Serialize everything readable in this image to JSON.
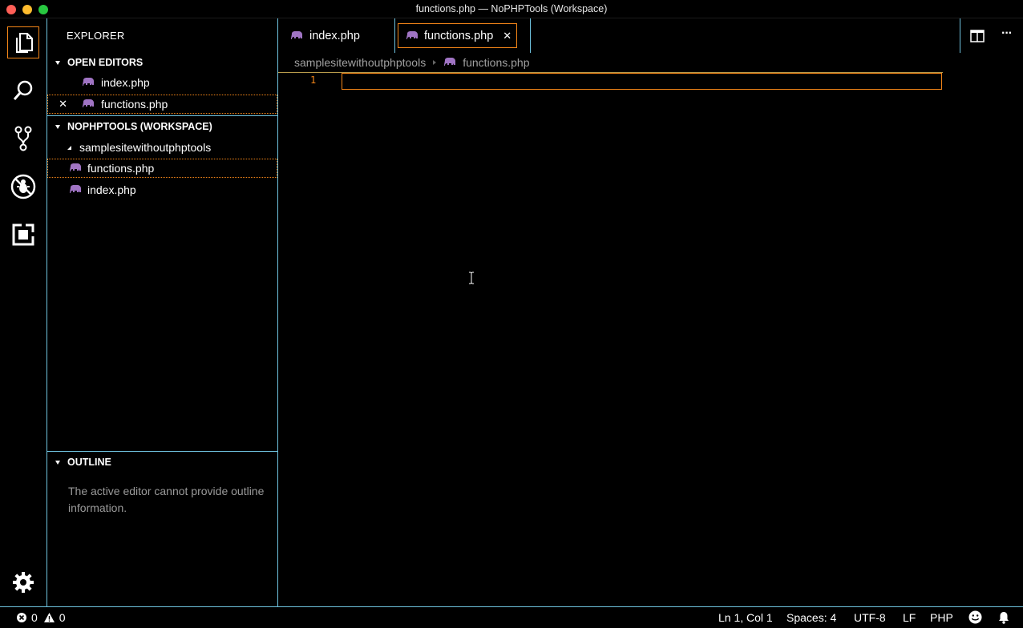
{
  "window": {
    "title": "functions.php — NoPHPTools (Workspace)",
    "traffic_colors": {
      "close": "#ff5f57",
      "minimize": "#febc2e",
      "maximize": "#28c840"
    }
  },
  "theme": {
    "focus_color": "#f38518",
    "border_color": "#6fc3df",
    "php_icon_color": "#a074c4"
  },
  "activity_bar": {
    "items": [
      {
        "name": "explorer-icon",
        "active": true
      },
      {
        "name": "search-icon"
      },
      {
        "name": "source-control-icon"
      },
      {
        "name": "debug-icon"
      },
      {
        "name": "extensions-icon"
      },
      {
        "name": "gear-icon"
      }
    ]
  },
  "sidebar": {
    "title": "EXPLORER",
    "open_editors": {
      "header": "OPEN EDITORS",
      "items": [
        {
          "label": "index.php",
          "icon": "php-elephant-icon"
        },
        {
          "label": "functions.php",
          "icon": "php-elephant-icon",
          "close_glyph": "✕"
        }
      ]
    },
    "workspace": {
      "header": "NOPHPTOOLS (WORKSPACE)",
      "folder": "samplesitewithoutphptools",
      "files": [
        {
          "label": "functions.php",
          "icon": "php-elephant-icon"
        },
        {
          "label": "index.php",
          "icon": "php-elephant-icon"
        }
      ]
    },
    "outline": {
      "header": "OUTLINE",
      "message": "The active editor cannot provide outline information."
    }
  },
  "editor": {
    "tabs": [
      {
        "label": "index.php",
        "active": false
      },
      {
        "label": "functions.php",
        "active": true,
        "close_glyph": "✕"
      }
    ],
    "breadcrumb": {
      "folder": "samplesitewithoutphptools",
      "file": "functions.php"
    },
    "line_numbers": [
      "1"
    ],
    "actions": {
      "more_glyph": "···"
    }
  },
  "status_bar": {
    "errors": "0",
    "warnings": "0",
    "position": "Ln 1, Col 1",
    "spaces": "Spaces: 4",
    "encoding": "UTF-8",
    "eol": "LF",
    "language": "PHP"
  }
}
